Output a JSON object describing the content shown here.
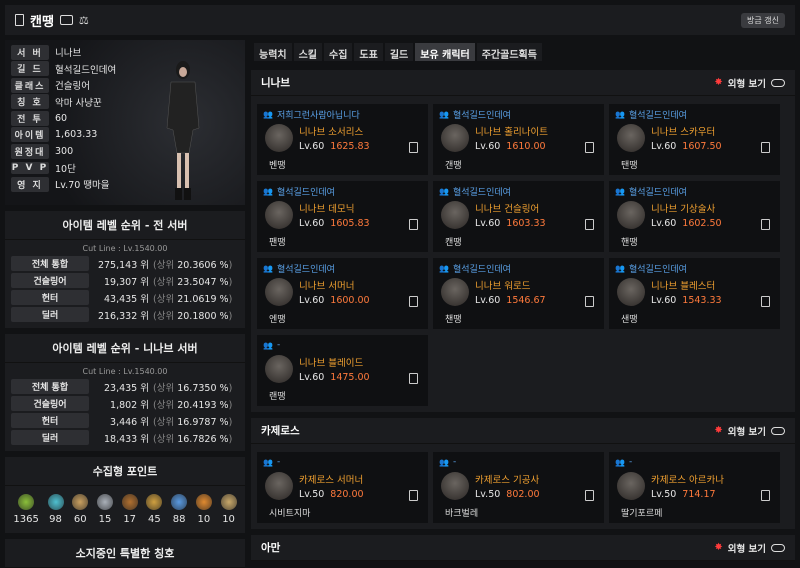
{
  "header": {
    "title": "캔땡",
    "refresh_label": "방금 갱신"
  },
  "profile": {
    "rows": [
      {
        "label": "서 버",
        "value": "니나브"
      },
      {
        "label": "길 드",
        "value": "혈석길드인데여"
      },
      {
        "label": "클래스",
        "value": "건슬링어"
      },
      {
        "label": "칭 호",
        "value": "악마 사냥꾼"
      },
      {
        "label": "전 투",
        "value": "60"
      },
      {
        "label": "아이템",
        "value": "1,603.33"
      },
      {
        "label": "원정대",
        "value": "300"
      },
      {
        "label": "P V P",
        "value": "10단"
      },
      {
        "label": "영 지",
        "value": "Lv.70 땡마을"
      }
    ]
  },
  "ranking_all": {
    "title": "아이템 레벨 순위 - 전 서버",
    "cutline": "Cut Line : Lv.1540.00",
    "rows": [
      {
        "label": "전체 통합",
        "rank": "275,143 위",
        "pct": "20.3606 %"
      },
      {
        "label": "건슬링어",
        "rank": "19,307 위",
        "pct": "23.5047 %"
      },
      {
        "label": "헌터",
        "rank": "43,435 위",
        "pct": "21.0619 %"
      },
      {
        "label": "딜러",
        "rank": "216,332 위",
        "pct": "20.1800 %"
      }
    ]
  },
  "ranking_server": {
    "title": "아이템 레벨 순위 - 니나브 서버",
    "cutline": "Cut Line : Lv.1540.00",
    "rows": [
      {
        "label": "전체 통합",
        "rank": "23,435 위",
        "pct": "16.7350 %"
      },
      {
        "label": "건슬링어",
        "rank": "1,802 위",
        "pct": "20.4193 %"
      },
      {
        "label": "헌터",
        "rank": "3,446 위",
        "pct": "16.9787 %"
      },
      {
        "label": "딜러",
        "rank": "18,433 위",
        "pct": "16.7826 %"
      }
    ]
  },
  "rank_prefix": "(상위",
  "rank_suffix": ")",
  "collect": {
    "title": "수집형 포인트",
    "items": [
      {
        "value": "1365",
        "color": "#8bbf3a"
      },
      {
        "value": "98",
        "color": "#4fc0d0"
      },
      {
        "value": "60",
        "color": "#c9a060"
      },
      {
        "value": "15",
        "color": "#aab0b8"
      },
      {
        "value": "17",
        "color": "#b07030"
      },
      {
        "value": "45",
        "color": "#d0a040"
      },
      {
        "value": "88",
        "color": "#5a9ae0"
      },
      {
        "value": "10",
        "color": "#e08a30"
      },
      {
        "value": "10",
        "color": "#c8a86a"
      }
    ]
  },
  "titles_panel": {
    "title": "소지중인 특별한 칭호"
  },
  "tabs": [
    "능력치",
    "스킬",
    "수집",
    "도표",
    "길드",
    "보유 캐릭터",
    "주간골드획득"
  ],
  "active_tab": 5,
  "view_label": "외형 보기",
  "servers": [
    {
      "name": "니나브",
      "chars": [
        {
          "guild": "저희그런사람아닙니다",
          "server": "니나브",
          "cls": "소서리스",
          "lv": "Lv.60",
          "il": "1625.83",
          "nick": "벤땡"
        },
        {
          "guild": "혈석길드인데여",
          "server": "니나브",
          "cls": "홀리나이트",
          "lv": "Lv.60",
          "il": "1610.00",
          "nick": "갠땡"
        },
        {
          "guild": "혈석길드인데여",
          "server": "니나브",
          "cls": "스카우터",
          "lv": "Lv.60",
          "il": "1607.50",
          "nick": "탠땡"
        },
        {
          "guild": "혈석길드인데여",
          "server": "니나브",
          "cls": "데모닉",
          "lv": "Lv.60",
          "il": "1605.83",
          "nick": "팬땡"
        },
        {
          "guild": "혈석길드인데여",
          "server": "니나브",
          "cls": "건슬링어",
          "lv": "Lv.60",
          "il": "1603.33",
          "nick": "캔땡"
        },
        {
          "guild": "혈석길드인데여",
          "server": "니나브",
          "cls": "기상술사",
          "lv": "Lv.60",
          "il": "1602.50",
          "nick": "핸땡"
        },
        {
          "guild": "혈석길드인데여",
          "server": "니나브",
          "cls": "서머너",
          "lv": "Lv.60",
          "il": "1600.00",
          "nick": "엔땡"
        },
        {
          "guild": "혈석길드인데여",
          "server": "니나브",
          "cls": "워로드",
          "lv": "Lv.60",
          "il": "1546.67",
          "nick": "챈땡"
        },
        {
          "guild": "혈석길드인데여",
          "server": "니나브",
          "cls": "블레스터",
          "lv": "Lv.60",
          "il": "1543.33",
          "nick": "샌땡"
        },
        {
          "guild": "-",
          "server": "니나브",
          "cls": "블레이드",
          "lv": "Lv.60",
          "il": "1475.00",
          "nick": "랜땡"
        }
      ]
    },
    {
      "name": "카제로스",
      "chars": [
        {
          "guild": "-",
          "server": "카제로스",
          "cls": "서머너",
          "lv": "Lv.50",
          "il": "820.00",
          "nick": "시비트지마"
        },
        {
          "guild": "-",
          "server": "카제로스",
          "cls": "기공사",
          "lv": "Lv.50",
          "il": "802.00",
          "nick": "바크벌레"
        },
        {
          "guild": "-",
          "server": "카제로스",
          "cls": "아르카나",
          "lv": "Lv.50",
          "il": "714.17",
          "nick": "딸기포르페"
        }
      ]
    },
    {
      "name": "아만",
      "chars": []
    }
  ]
}
